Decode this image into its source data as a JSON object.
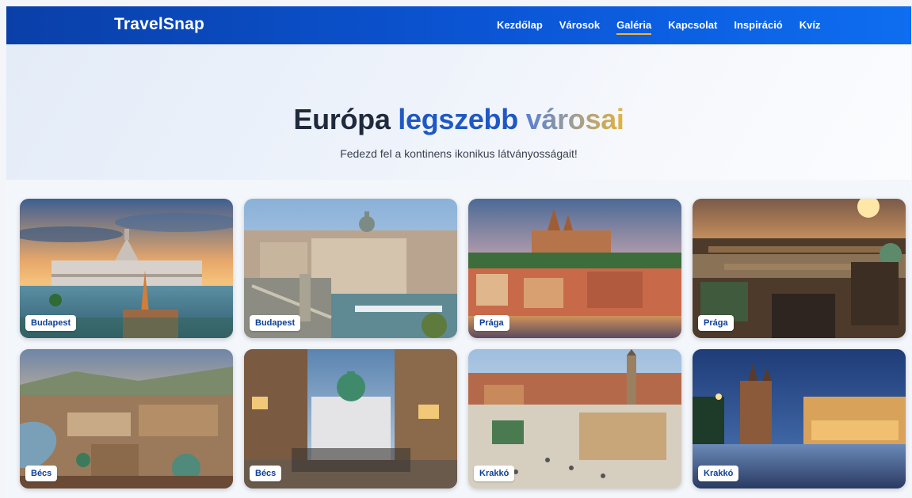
{
  "nav": {
    "brand": "TravelSnap",
    "items": [
      {
        "label": "Kezdőlap"
      },
      {
        "label": "Városok"
      },
      {
        "label": "Galéria",
        "active": true
      },
      {
        "label": "Kapcsolat"
      },
      {
        "label": "Inspiráció"
      },
      {
        "label": "Kvíz"
      }
    ],
    "active_underline_color": "#f2b63a"
  },
  "hero": {
    "title_part1": "Európa",
    "title_part2": "legszebb",
    "title_part3": "városai",
    "subtitle": "Fedezd fel a kontinens ikonikus látványosságait!"
  },
  "gallery": {
    "cards": [
      {
        "label": "Budapest"
      },
      {
        "label": "Budapest"
      },
      {
        "label": "Prága"
      },
      {
        "label": "Prága"
      },
      {
        "label": "Bécs"
      },
      {
        "label": "Bécs"
      },
      {
        "label": "Krakkó"
      },
      {
        "label": "Krakkó"
      }
    ]
  }
}
